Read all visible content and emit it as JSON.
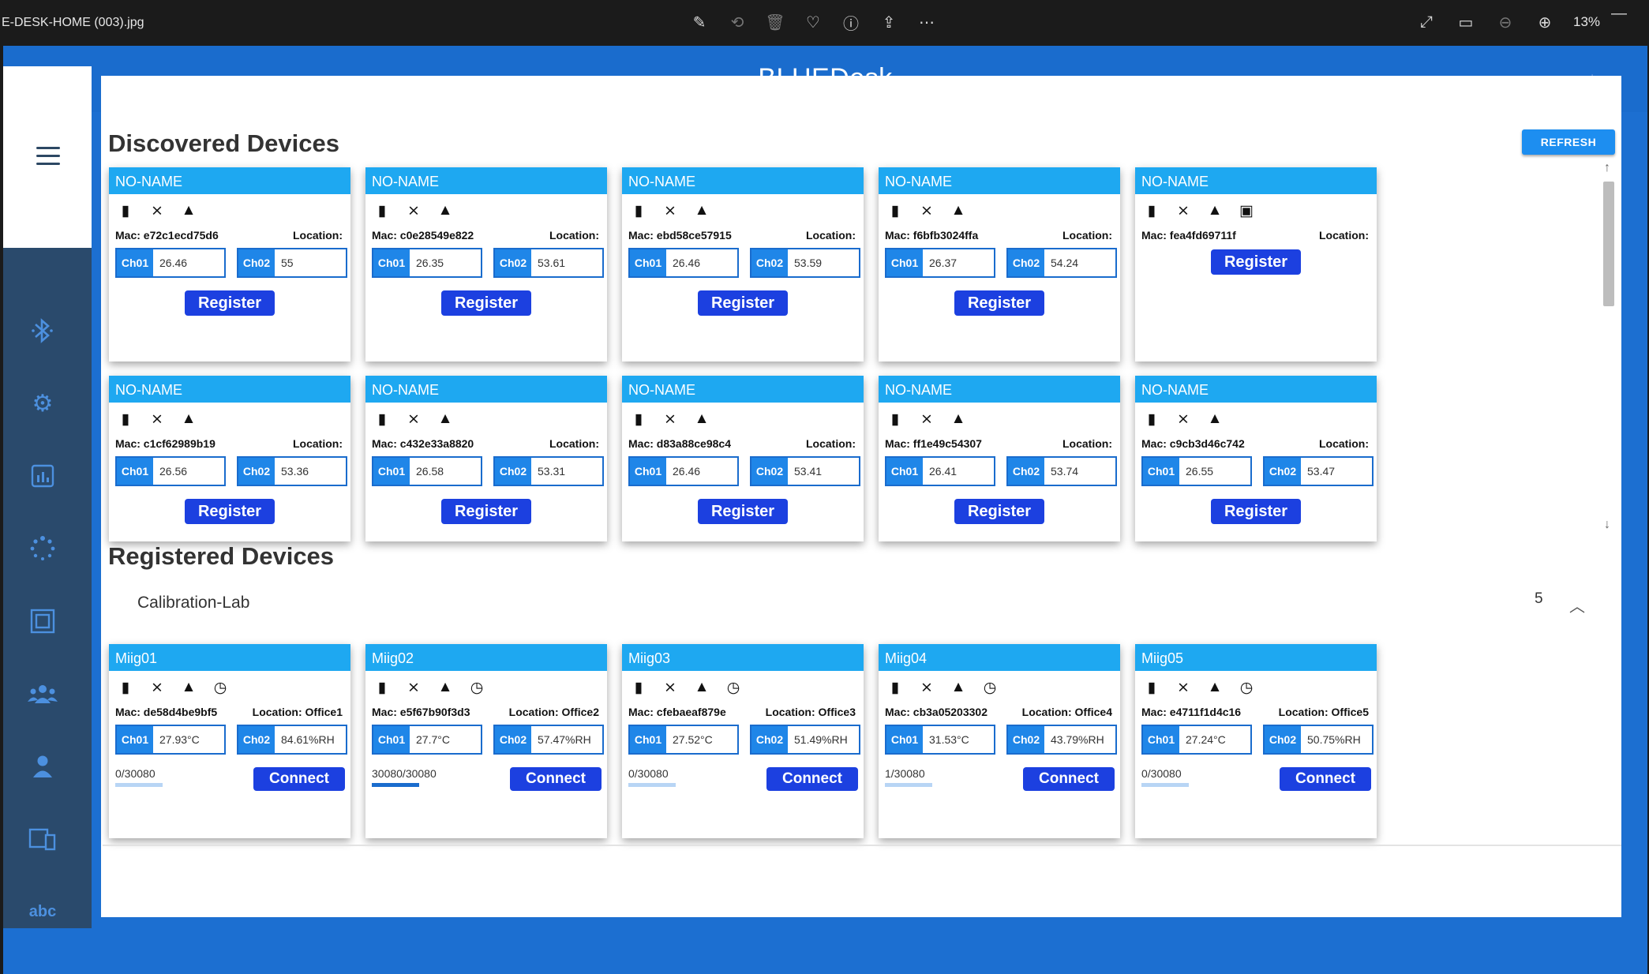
{
  "viewer": {
    "filename": "E-DESK-HOME (003).jpg",
    "zoom": "13%",
    "tool_icons": [
      "edit-icon",
      "rotate-icon",
      "delete-icon",
      "heart-icon",
      "info-icon",
      "share-icon",
      "more-icon"
    ],
    "right_icons": [
      "fullscreen-icon",
      "slideshow-icon",
      "zoom-out-icon",
      "zoom-in-icon"
    ]
  },
  "app": {
    "title": "BLUEDesk",
    "nav_icons": [
      "bluetooth-icon",
      "settings-icon",
      "chart-icon",
      "spinner-icon",
      "frame-icon",
      "users-icon",
      "user-icon",
      "devices-icon",
      "abc-icon"
    ]
  },
  "discovered": {
    "title": "Discovered Devices",
    "refresh_label": "REFRESH",
    "register_label": "Register",
    "location_label": "Location:",
    "devices": [
      {
        "name": "NO-NAME",
        "mac": "Mac: e72c1ecd75d6",
        "ch1_label": "Ch01",
        "ch1": "26.46",
        "ch2_label": "Ch02",
        "ch2": "55"
      },
      {
        "name": "NO-NAME",
        "mac": "Mac: c0e28549e822",
        "ch1_label": "Ch01",
        "ch1": "26.35",
        "ch2_label": "Ch02",
        "ch2": "53.61"
      },
      {
        "name": "NO-NAME",
        "mac": "Mac: ebd58ce57915",
        "ch1_label": "Ch01",
        "ch1": "26.46",
        "ch2_label": "Ch02",
        "ch2": "53.59"
      },
      {
        "name": "NO-NAME",
        "mac": "Mac: f6bfb3024ffa",
        "ch1_label": "Ch01",
        "ch1": "26.37",
        "ch2_label": "Ch02",
        "ch2": "54.24"
      },
      {
        "name": "NO-NAME",
        "mac": "Mac: fea4fd69711f"
      },
      {
        "name": "NO-NAME",
        "mac": "Mac: c1cf62989b19",
        "ch1_label": "Ch01",
        "ch1": "26.56",
        "ch2_label": "Ch02",
        "ch2": "53.36"
      },
      {
        "name": "NO-NAME",
        "mac": "Mac: c432e33a8820",
        "ch1_label": "Ch01",
        "ch1": "26.58",
        "ch2_label": "Ch02",
        "ch2": "53.31"
      },
      {
        "name": "NO-NAME",
        "mac": "Mac: d83a88ce98c4",
        "ch1_label": "Ch01",
        "ch1": "26.46",
        "ch2_label": "Ch02",
        "ch2": "53.41"
      },
      {
        "name": "NO-NAME",
        "mac": "Mac: ff1e49c54307",
        "ch1_label": "Ch01",
        "ch1": "26.41",
        "ch2_label": "Ch02",
        "ch2": "53.74"
      },
      {
        "name": "NO-NAME",
        "mac": "Mac: c9cb3d46c742",
        "ch1_label": "Ch01",
        "ch1": "26.55",
        "ch2_label": "Ch02",
        "ch2": "53.47"
      }
    ]
  },
  "registered": {
    "title": "Registered Devices",
    "group_name": "Calibration-Lab",
    "group_count": "5",
    "connect_label": "Connect",
    "devices": [
      {
        "name": "Miig01",
        "mac": "Mac: de58d4be9bf5",
        "location": "Location: Office1",
        "ch1_label": "Ch01",
        "ch1": "27.93°C",
        "ch2_label": "Ch02",
        "ch2": "84.61%RH",
        "progress": "0/30080",
        "progress_fraction": 0.0
      },
      {
        "name": "Miig02",
        "mac": "Mac: e5f67b90f3d3",
        "location": "Location: Office2",
        "ch1_label": "Ch01",
        "ch1": "27.7°C",
        "ch2_label": "Ch02",
        "ch2": "57.47%RH",
        "progress": "30080/30080",
        "progress_fraction": 1.0
      },
      {
        "name": "Miig03",
        "mac": "Mac: cfebaeaf879e",
        "location": "Location: Office3",
        "ch1_label": "Ch01",
        "ch1": "27.52°C",
        "ch2_label": "Ch02",
        "ch2": "51.49%RH",
        "progress": "0/30080",
        "progress_fraction": 0.0
      },
      {
        "name": "Miig04",
        "mac": "Mac: cb3a05203302",
        "location": "Location: Office4",
        "ch1_label": "Ch01",
        "ch1": "31.53°C",
        "ch2_label": "Ch02",
        "ch2": "43.79%RH",
        "progress": "1/30080",
        "progress_fraction": 0.0
      },
      {
        "name": "Miig05",
        "mac": "Mac: e4711f1d4c16",
        "location": "Location: Office5",
        "ch1_label": "Ch01",
        "ch1": "27.24°C",
        "ch2_label": "Ch02",
        "ch2": "50.75%RH",
        "progress": "0/30080",
        "progress_fraction": 0.0
      }
    ]
  }
}
